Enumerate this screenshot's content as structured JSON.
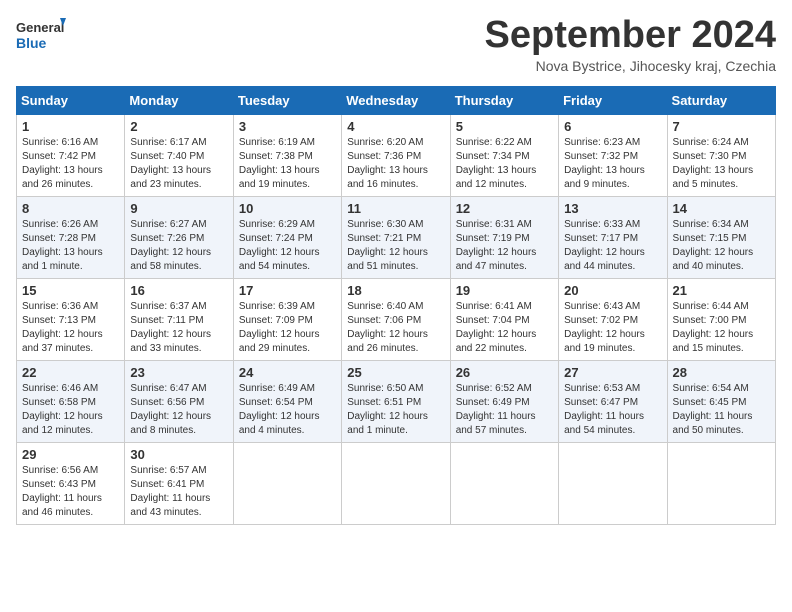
{
  "logo": {
    "line1": "General",
    "line2": "Blue"
  },
  "title": "September 2024",
  "subtitle": "Nova Bystrice, Jihocesky kraj, Czechia",
  "days_of_week": [
    "Sunday",
    "Monday",
    "Tuesday",
    "Wednesday",
    "Thursday",
    "Friday",
    "Saturday"
  ],
  "weeks": [
    [
      {
        "num": "1",
        "rise": "6:16 AM",
        "set": "7:42 PM",
        "daylight": "13 hours and 26 minutes."
      },
      {
        "num": "2",
        "rise": "6:17 AM",
        "set": "7:40 PM",
        "daylight": "13 hours and 23 minutes."
      },
      {
        "num": "3",
        "rise": "6:19 AM",
        "set": "7:38 PM",
        "daylight": "13 hours and 19 minutes."
      },
      {
        "num": "4",
        "rise": "6:20 AM",
        "set": "7:36 PM",
        "daylight": "13 hours and 16 minutes."
      },
      {
        "num": "5",
        "rise": "6:22 AM",
        "set": "7:34 PM",
        "daylight": "13 hours and 12 minutes."
      },
      {
        "num": "6",
        "rise": "6:23 AM",
        "set": "7:32 PM",
        "daylight": "13 hours and 9 minutes."
      },
      {
        "num": "7",
        "rise": "6:24 AM",
        "set": "7:30 PM",
        "daylight": "13 hours and 5 minutes."
      }
    ],
    [
      {
        "num": "8",
        "rise": "6:26 AM",
        "set": "7:28 PM",
        "daylight": "13 hours and 1 minute."
      },
      {
        "num": "9",
        "rise": "6:27 AM",
        "set": "7:26 PM",
        "daylight": "12 hours and 58 minutes."
      },
      {
        "num": "10",
        "rise": "6:29 AM",
        "set": "7:24 PM",
        "daylight": "12 hours and 54 minutes."
      },
      {
        "num": "11",
        "rise": "6:30 AM",
        "set": "7:21 PM",
        "daylight": "12 hours and 51 minutes."
      },
      {
        "num": "12",
        "rise": "6:31 AM",
        "set": "7:19 PM",
        "daylight": "12 hours and 47 minutes."
      },
      {
        "num": "13",
        "rise": "6:33 AM",
        "set": "7:17 PM",
        "daylight": "12 hours and 44 minutes."
      },
      {
        "num": "14",
        "rise": "6:34 AM",
        "set": "7:15 PM",
        "daylight": "12 hours and 40 minutes."
      }
    ],
    [
      {
        "num": "15",
        "rise": "6:36 AM",
        "set": "7:13 PM",
        "daylight": "12 hours and 37 minutes."
      },
      {
        "num": "16",
        "rise": "6:37 AM",
        "set": "7:11 PM",
        "daylight": "12 hours and 33 minutes."
      },
      {
        "num": "17",
        "rise": "6:39 AM",
        "set": "7:09 PM",
        "daylight": "12 hours and 29 minutes."
      },
      {
        "num": "18",
        "rise": "6:40 AM",
        "set": "7:06 PM",
        "daylight": "12 hours and 26 minutes."
      },
      {
        "num": "19",
        "rise": "6:41 AM",
        "set": "7:04 PM",
        "daylight": "12 hours and 22 minutes."
      },
      {
        "num": "20",
        "rise": "6:43 AM",
        "set": "7:02 PM",
        "daylight": "12 hours and 19 minutes."
      },
      {
        "num": "21",
        "rise": "6:44 AM",
        "set": "7:00 PM",
        "daylight": "12 hours and 15 minutes."
      }
    ],
    [
      {
        "num": "22",
        "rise": "6:46 AM",
        "set": "6:58 PM",
        "daylight": "12 hours and 12 minutes."
      },
      {
        "num": "23",
        "rise": "6:47 AM",
        "set": "6:56 PM",
        "daylight": "12 hours and 8 minutes."
      },
      {
        "num": "24",
        "rise": "6:49 AM",
        "set": "6:54 PM",
        "daylight": "12 hours and 4 minutes."
      },
      {
        "num": "25",
        "rise": "6:50 AM",
        "set": "6:51 PM",
        "daylight": "12 hours and 1 minute."
      },
      {
        "num": "26",
        "rise": "6:52 AM",
        "set": "6:49 PM",
        "daylight": "11 hours and 57 minutes."
      },
      {
        "num": "27",
        "rise": "6:53 AM",
        "set": "6:47 PM",
        "daylight": "11 hours and 54 minutes."
      },
      {
        "num": "28",
        "rise": "6:54 AM",
        "set": "6:45 PM",
        "daylight": "11 hours and 50 minutes."
      }
    ],
    [
      {
        "num": "29",
        "rise": "6:56 AM",
        "set": "6:43 PM",
        "daylight": "11 hours and 46 minutes."
      },
      {
        "num": "30",
        "rise": "6:57 AM",
        "set": "6:41 PM",
        "daylight": "11 hours and 43 minutes."
      },
      null,
      null,
      null,
      null,
      null
    ]
  ]
}
